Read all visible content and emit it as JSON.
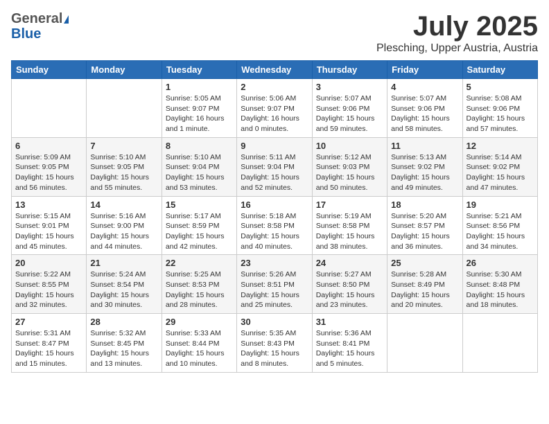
{
  "header": {
    "logo_general": "General",
    "logo_blue": "Blue",
    "title": "July 2025",
    "location": "Plesching, Upper Austria, Austria"
  },
  "weekdays": [
    "Sunday",
    "Monday",
    "Tuesday",
    "Wednesday",
    "Thursday",
    "Friday",
    "Saturday"
  ],
  "weeks": [
    [
      {
        "day": "",
        "info": ""
      },
      {
        "day": "",
        "info": ""
      },
      {
        "day": "1",
        "info": "Sunrise: 5:05 AM\nSunset: 9:07 PM\nDaylight: 16 hours\nand 1 minute."
      },
      {
        "day": "2",
        "info": "Sunrise: 5:06 AM\nSunset: 9:07 PM\nDaylight: 16 hours\nand 0 minutes."
      },
      {
        "day": "3",
        "info": "Sunrise: 5:07 AM\nSunset: 9:06 PM\nDaylight: 15 hours\nand 59 minutes."
      },
      {
        "day": "4",
        "info": "Sunrise: 5:07 AM\nSunset: 9:06 PM\nDaylight: 15 hours\nand 58 minutes."
      },
      {
        "day": "5",
        "info": "Sunrise: 5:08 AM\nSunset: 9:06 PM\nDaylight: 15 hours\nand 57 minutes."
      }
    ],
    [
      {
        "day": "6",
        "info": "Sunrise: 5:09 AM\nSunset: 9:05 PM\nDaylight: 15 hours\nand 56 minutes."
      },
      {
        "day": "7",
        "info": "Sunrise: 5:10 AM\nSunset: 9:05 PM\nDaylight: 15 hours\nand 55 minutes."
      },
      {
        "day": "8",
        "info": "Sunrise: 5:10 AM\nSunset: 9:04 PM\nDaylight: 15 hours\nand 53 minutes."
      },
      {
        "day": "9",
        "info": "Sunrise: 5:11 AM\nSunset: 9:04 PM\nDaylight: 15 hours\nand 52 minutes."
      },
      {
        "day": "10",
        "info": "Sunrise: 5:12 AM\nSunset: 9:03 PM\nDaylight: 15 hours\nand 50 minutes."
      },
      {
        "day": "11",
        "info": "Sunrise: 5:13 AM\nSunset: 9:02 PM\nDaylight: 15 hours\nand 49 minutes."
      },
      {
        "day": "12",
        "info": "Sunrise: 5:14 AM\nSunset: 9:02 PM\nDaylight: 15 hours\nand 47 minutes."
      }
    ],
    [
      {
        "day": "13",
        "info": "Sunrise: 5:15 AM\nSunset: 9:01 PM\nDaylight: 15 hours\nand 45 minutes."
      },
      {
        "day": "14",
        "info": "Sunrise: 5:16 AM\nSunset: 9:00 PM\nDaylight: 15 hours\nand 44 minutes."
      },
      {
        "day": "15",
        "info": "Sunrise: 5:17 AM\nSunset: 8:59 PM\nDaylight: 15 hours\nand 42 minutes."
      },
      {
        "day": "16",
        "info": "Sunrise: 5:18 AM\nSunset: 8:58 PM\nDaylight: 15 hours\nand 40 minutes."
      },
      {
        "day": "17",
        "info": "Sunrise: 5:19 AM\nSunset: 8:58 PM\nDaylight: 15 hours\nand 38 minutes."
      },
      {
        "day": "18",
        "info": "Sunrise: 5:20 AM\nSunset: 8:57 PM\nDaylight: 15 hours\nand 36 minutes."
      },
      {
        "day": "19",
        "info": "Sunrise: 5:21 AM\nSunset: 8:56 PM\nDaylight: 15 hours\nand 34 minutes."
      }
    ],
    [
      {
        "day": "20",
        "info": "Sunrise: 5:22 AM\nSunset: 8:55 PM\nDaylight: 15 hours\nand 32 minutes."
      },
      {
        "day": "21",
        "info": "Sunrise: 5:24 AM\nSunset: 8:54 PM\nDaylight: 15 hours\nand 30 minutes."
      },
      {
        "day": "22",
        "info": "Sunrise: 5:25 AM\nSunset: 8:53 PM\nDaylight: 15 hours\nand 28 minutes."
      },
      {
        "day": "23",
        "info": "Sunrise: 5:26 AM\nSunset: 8:51 PM\nDaylight: 15 hours\nand 25 minutes."
      },
      {
        "day": "24",
        "info": "Sunrise: 5:27 AM\nSunset: 8:50 PM\nDaylight: 15 hours\nand 23 minutes."
      },
      {
        "day": "25",
        "info": "Sunrise: 5:28 AM\nSunset: 8:49 PM\nDaylight: 15 hours\nand 20 minutes."
      },
      {
        "day": "26",
        "info": "Sunrise: 5:30 AM\nSunset: 8:48 PM\nDaylight: 15 hours\nand 18 minutes."
      }
    ],
    [
      {
        "day": "27",
        "info": "Sunrise: 5:31 AM\nSunset: 8:47 PM\nDaylight: 15 hours\nand 15 minutes."
      },
      {
        "day": "28",
        "info": "Sunrise: 5:32 AM\nSunset: 8:45 PM\nDaylight: 15 hours\nand 13 minutes."
      },
      {
        "day": "29",
        "info": "Sunrise: 5:33 AM\nSunset: 8:44 PM\nDaylight: 15 hours\nand 10 minutes."
      },
      {
        "day": "30",
        "info": "Sunrise: 5:35 AM\nSunset: 8:43 PM\nDaylight: 15 hours\nand 8 minutes."
      },
      {
        "day": "31",
        "info": "Sunrise: 5:36 AM\nSunset: 8:41 PM\nDaylight: 15 hours\nand 5 minutes."
      },
      {
        "day": "",
        "info": ""
      },
      {
        "day": "",
        "info": ""
      }
    ]
  ]
}
